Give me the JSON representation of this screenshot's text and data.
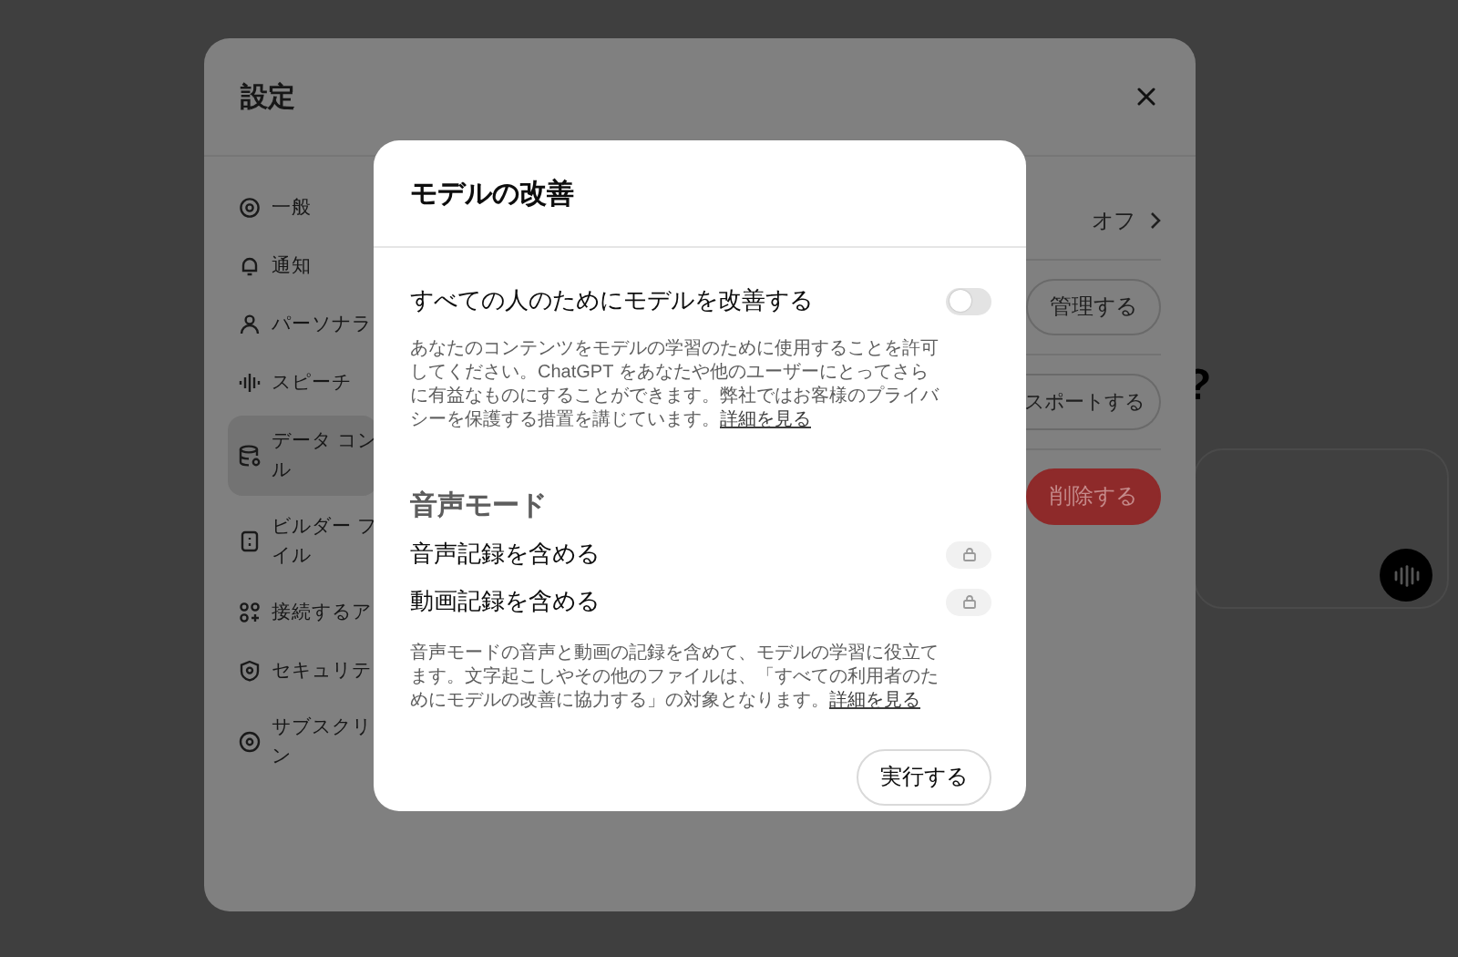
{
  "background": {
    "heading_fragment": "?"
  },
  "settings": {
    "title": "設定",
    "sidebar": {
      "items": [
        {
          "kind": "gear",
          "lines": [
            "一般"
          ],
          "selected": false
        },
        {
          "kind": "bell",
          "lines": [
            "通知"
          ],
          "selected": false
        },
        {
          "kind": "person",
          "lines": [
            "パーソナラ"
          ],
          "selected": false
        },
        {
          "kind": "wave",
          "lines": [
            "スピーチ"
          ],
          "selected": false
        },
        {
          "kind": "database",
          "lines": [
            "データ コン",
            "ル"
          ],
          "selected": true
        },
        {
          "kind": "card",
          "lines": [
            "ビルダー フ",
            "イル"
          ],
          "selected": false
        },
        {
          "kind": "apps",
          "lines": [
            "接続するア"
          ],
          "selected": false
        },
        {
          "kind": "shield",
          "lines": [
            "セキュリテ"
          ],
          "selected": false
        },
        {
          "kind": "star",
          "lines": [
            "サブスクリ",
            "ン"
          ],
          "selected": false
        }
      ]
    },
    "panel": {
      "rows": [
        {
          "kind": "value",
          "text": "オフ"
        },
        {
          "kind": "button",
          "text": "管理する"
        },
        {
          "kind": "partial_button",
          "text": "スポートする"
        },
        {
          "kind": "danger",
          "text": "削除する"
        }
      ]
    }
  },
  "modal": {
    "title": "モデルの改善",
    "setting": {
      "label": "すべての人のためにモデルを改善する",
      "on": false,
      "disabled": false
    },
    "description": "あなたのコンテンツをモデルの学習のために使用することを許可してください。ChatGPT をあなたや他のユーザーにとってさらに有益なものにすることができます。弊社ではお客様のプライバシーを保護する措置を講じています。",
    "description_link": "詳細を見る",
    "section_title": "音声モード",
    "options": [
      {
        "label": "音声記録を含める",
        "on": false,
        "disabled": true
      },
      {
        "label": "動画記録を含める",
        "on": false,
        "disabled": true
      }
    ],
    "note": "音声モードの音声と動画の記録を含めて、モデルの学習に役立てます。文字起こしやその他のファイルは、「すべての利用者のためにモデルの改善に協力する」の対象となります。",
    "note_link": "詳細を見る",
    "button": "実行する"
  }
}
